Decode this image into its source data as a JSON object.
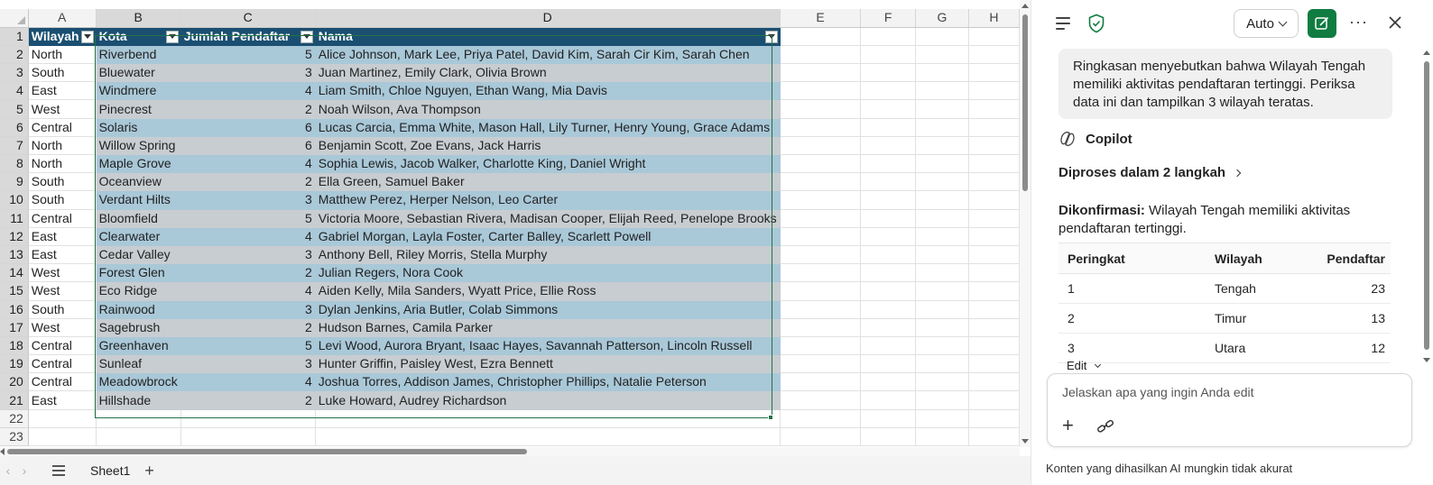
{
  "sheet": {
    "columns": [
      "A",
      "B",
      "C",
      "D",
      "E",
      "F",
      "G",
      "H"
    ],
    "row_numbers": [
      "1",
      "2",
      "3",
      "4",
      "5",
      "6",
      "7",
      "8",
      "9",
      "10",
      "11",
      "12",
      "13",
      "14",
      "15",
      "16",
      "17",
      "18",
      "19",
      "20",
      "21",
      "22",
      "23"
    ],
    "headers": [
      "Wilayah",
      "Kota",
      "Jumlah Pendaftar",
      "Nama"
    ],
    "rows": [
      [
        "North",
        "Riverbend",
        "5",
        "Alice Johnson, Mark Lee, Priya Patel, David Kim, Sarah Cir Kim, Sarah Chen"
      ],
      [
        "South",
        "Bluewater",
        "3",
        "Juan Martinez, Emily Clark, Olivia Brown"
      ],
      [
        "East",
        "Windmere",
        "4",
        "Liam Smith, Chloe Nguyen, Ethan Wang, Mia Davis"
      ],
      [
        "West",
        "Pinecrest",
        "2",
        "Noah Wilson, Ava Thompson"
      ],
      [
        "Central",
        "Solaris",
        "6",
        "Lucas Carcia, Emma White, Mason Hall, Lily Turner, Henry Young, Grace Adams"
      ],
      [
        "North",
        "Willow Spring",
        "6",
        "Benjamin Scott, Zoe Evans, Jack Harris"
      ],
      [
        "North",
        "Maple Grove",
        "4",
        "Sophia Lewis, Jacob Walker, Charlotte King, Daniel Wright"
      ],
      [
        "South",
        "Oceanview",
        "2",
        "Ella Green, Samuel Baker"
      ],
      [
        "South",
        "Verdant Hilts",
        "3",
        "Matthew Perez, Herper Nelson, Leo Carter"
      ],
      [
        "Central",
        "Bloomfield",
        "5",
        "Victoria Moore, Sebastian Rivera, Madisan Cooper, Elijah Reed, Penelope Brooks"
      ],
      [
        "East",
        "Clearwater",
        "4",
        "Gabriel Morgan, Layla Foster, Carter Balley, Scarlett Powell"
      ],
      [
        "East",
        "Cedar Valley",
        "3",
        "Anthony Bell, Riley Morris, Stella Murphy"
      ],
      [
        "West",
        "Forest Glen",
        "2",
        "Julian Regers, Nora Cook"
      ],
      [
        "West",
        "Eco Ridge",
        "4",
        "Aiden Kelly, Mila Sanders, Wyatt Price, Ellie Ross"
      ],
      [
        "South",
        "Rainwood",
        "3",
        "Dylan Jenkins, Aria Butler, Colab Simmons"
      ],
      [
        "West",
        "Sagebrush",
        "2",
        "Hudson Barnes, Camila Parker"
      ],
      [
        "Central",
        "Greenhaven",
        "5",
        "Levi Wood, Aurora Bryant, Isaac Hayes, Savannah Patterson, Lincoln Russell"
      ],
      [
        "Central",
        "Sunleaf",
        "3",
        "Hunter Griffin, Paisley West, Ezra Bennett"
      ],
      [
        "Central",
        "Meadowbrock",
        "4",
        "Joshua Torres, Addison James, Christopher Phillips, Natalie Peterson"
      ],
      [
        "East",
        "Hillshade",
        "2",
        "Luke Howard, Audrey Richardson"
      ]
    ],
    "tab_name": "Sheet1",
    "colors": {
      "table_header": "#1b4f72",
      "band_blue": "#a9c8d8",
      "band_gray": "#c8cdd1",
      "selection": "#217346"
    }
  },
  "copilot": {
    "mode_label": "Auto",
    "user_message": "Ringkasan menyebutkan bahwa Wilayah Tengah memiliki aktivitas pendaftaran tertinggi. Periksa data ini dan tampilkan 3 wilayah teratas.",
    "assistant_name": "Copilot",
    "steps_label": "Diproses dalam 2 langkah",
    "confirm_label": "Dikonfirmasi:",
    "confirm_text": " Wilayah Tengah memiliki aktivitas pendaftaran tertinggi.",
    "table_headers": [
      "Peringkat",
      "Wilayah",
      "Pendaftar"
    ],
    "table_rows": [
      [
        "1",
        "Tengah",
        "23"
      ],
      [
        "2",
        "Timur",
        "13"
      ],
      [
        "3",
        "Utara",
        "12"
      ]
    ],
    "edit_label": "Edit",
    "input_placeholder": "Jelaskan apa yang ingin Anda edit",
    "disclaimer": "Konten yang dihasilkan AI mungkin tidak akurat",
    "accent_color": "#107c41"
  }
}
